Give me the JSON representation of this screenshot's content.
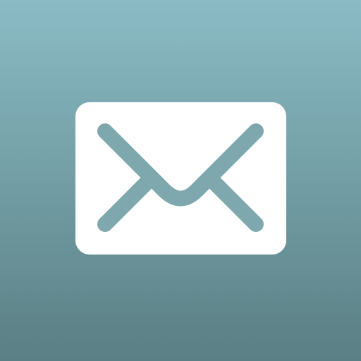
{
  "icon": {
    "name": "mail-icon",
    "background_top": "#8bbcc5",
    "background_bottom": "#5a7f84",
    "envelope_color": "#ffffff",
    "stroke_color": "#7ea8ae"
  }
}
